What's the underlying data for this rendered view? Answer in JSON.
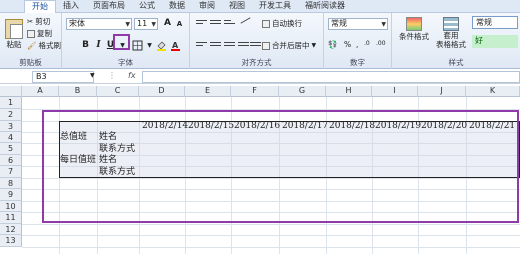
{
  "ribbon_tabs": [
    "开始",
    "插入",
    "页面布局",
    "公式",
    "数据",
    "审阅",
    "视图",
    "开发工具",
    "福昕阅读器"
  ],
  "clipboard": {
    "paste": "粘贴",
    "cut": "剪切",
    "copy": "复制",
    "format_painter": "格式刷",
    "label": "剪贴板"
  },
  "font": {
    "name": "宋体",
    "size": "11",
    "bold": "B",
    "italic": "I",
    "underline": "U",
    "grow": "A",
    "shrink": "A",
    "label": "字体"
  },
  "alignment": {
    "wrap": "自动换行",
    "merge": "合并后居中",
    "label": "对齐方式"
  },
  "number": {
    "format": "常规",
    "label": "数字"
  },
  "styles": {
    "conditional": "条件格式",
    "table_format": "套用",
    "table_format2": "表格格式",
    "style_normal": "常规",
    "style_good": "好",
    "label": "样式"
  },
  "formula_bar": {
    "name_box": "B3",
    "fx": "fx"
  },
  "columns": [
    "A",
    "B",
    "C",
    "D",
    "E",
    "F",
    "G",
    "H",
    "I",
    "J",
    "K"
  ],
  "rows": [
    "1",
    "2",
    "3",
    "4",
    "5",
    "6",
    "7",
    "8",
    "9",
    "10",
    "11",
    "12",
    "13"
  ],
  "dates": [
    "2018/2/14",
    "2018/2/15",
    "2018/2/16",
    "2018/2/17",
    "2018/2/18",
    "2018/2/19",
    "2018/2/20",
    "2018/2/21"
  ],
  "cells": {
    "b4": "总值班",
    "c4": "姓名",
    "c5": "联系方式",
    "b6": "每日值班",
    "c6": "姓名",
    "c7": "联系方式"
  }
}
